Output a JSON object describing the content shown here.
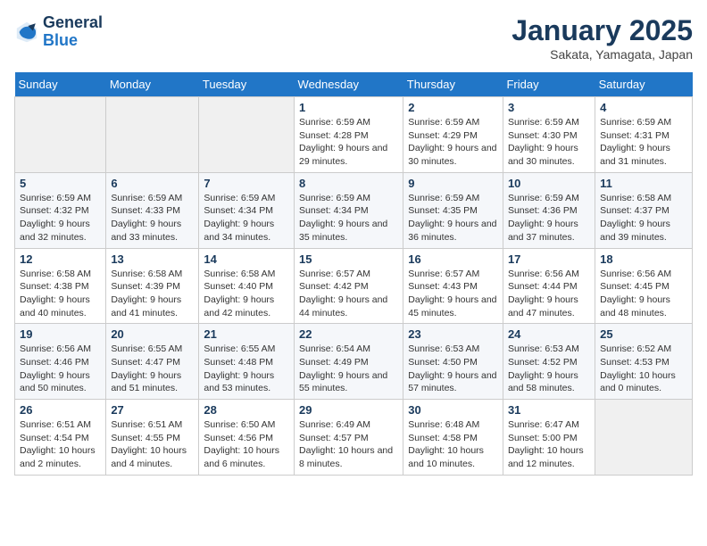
{
  "header": {
    "logo_line1": "General",
    "logo_line2": "Blue",
    "title": "January 2025",
    "subtitle": "Sakata, Yamagata, Japan"
  },
  "calendar": {
    "days_of_week": [
      "Sunday",
      "Monday",
      "Tuesday",
      "Wednesday",
      "Thursday",
      "Friday",
      "Saturday"
    ],
    "weeks": [
      [
        {
          "num": "",
          "detail": ""
        },
        {
          "num": "",
          "detail": ""
        },
        {
          "num": "",
          "detail": ""
        },
        {
          "num": "1",
          "detail": "Sunrise: 6:59 AM\nSunset: 4:28 PM\nDaylight: 9 hours and 29 minutes."
        },
        {
          "num": "2",
          "detail": "Sunrise: 6:59 AM\nSunset: 4:29 PM\nDaylight: 9 hours and 30 minutes."
        },
        {
          "num": "3",
          "detail": "Sunrise: 6:59 AM\nSunset: 4:30 PM\nDaylight: 9 hours and 30 minutes."
        },
        {
          "num": "4",
          "detail": "Sunrise: 6:59 AM\nSunset: 4:31 PM\nDaylight: 9 hours and 31 minutes."
        }
      ],
      [
        {
          "num": "5",
          "detail": "Sunrise: 6:59 AM\nSunset: 4:32 PM\nDaylight: 9 hours and 32 minutes."
        },
        {
          "num": "6",
          "detail": "Sunrise: 6:59 AM\nSunset: 4:33 PM\nDaylight: 9 hours and 33 minutes."
        },
        {
          "num": "7",
          "detail": "Sunrise: 6:59 AM\nSunset: 4:34 PM\nDaylight: 9 hours and 34 minutes."
        },
        {
          "num": "8",
          "detail": "Sunrise: 6:59 AM\nSunset: 4:34 PM\nDaylight: 9 hours and 35 minutes."
        },
        {
          "num": "9",
          "detail": "Sunrise: 6:59 AM\nSunset: 4:35 PM\nDaylight: 9 hours and 36 minutes."
        },
        {
          "num": "10",
          "detail": "Sunrise: 6:59 AM\nSunset: 4:36 PM\nDaylight: 9 hours and 37 minutes."
        },
        {
          "num": "11",
          "detail": "Sunrise: 6:58 AM\nSunset: 4:37 PM\nDaylight: 9 hours and 39 minutes."
        }
      ],
      [
        {
          "num": "12",
          "detail": "Sunrise: 6:58 AM\nSunset: 4:38 PM\nDaylight: 9 hours and 40 minutes."
        },
        {
          "num": "13",
          "detail": "Sunrise: 6:58 AM\nSunset: 4:39 PM\nDaylight: 9 hours and 41 minutes."
        },
        {
          "num": "14",
          "detail": "Sunrise: 6:58 AM\nSunset: 4:40 PM\nDaylight: 9 hours and 42 minutes."
        },
        {
          "num": "15",
          "detail": "Sunrise: 6:57 AM\nSunset: 4:42 PM\nDaylight: 9 hours and 44 minutes."
        },
        {
          "num": "16",
          "detail": "Sunrise: 6:57 AM\nSunset: 4:43 PM\nDaylight: 9 hours and 45 minutes."
        },
        {
          "num": "17",
          "detail": "Sunrise: 6:56 AM\nSunset: 4:44 PM\nDaylight: 9 hours and 47 minutes."
        },
        {
          "num": "18",
          "detail": "Sunrise: 6:56 AM\nSunset: 4:45 PM\nDaylight: 9 hours and 48 minutes."
        }
      ],
      [
        {
          "num": "19",
          "detail": "Sunrise: 6:56 AM\nSunset: 4:46 PM\nDaylight: 9 hours and 50 minutes."
        },
        {
          "num": "20",
          "detail": "Sunrise: 6:55 AM\nSunset: 4:47 PM\nDaylight: 9 hours and 51 minutes."
        },
        {
          "num": "21",
          "detail": "Sunrise: 6:55 AM\nSunset: 4:48 PM\nDaylight: 9 hours and 53 minutes."
        },
        {
          "num": "22",
          "detail": "Sunrise: 6:54 AM\nSunset: 4:49 PM\nDaylight: 9 hours and 55 minutes."
        },
        {
          "num": "23",
          "detail": "Sunrise: 6:53 AM\nSunset: 4:50 PM\nDaylight: 9 hours and 57 minutes."
        },
        {
          "num": "24",
          "detail": "Sunrise: 6:53 AM\nSunset: 4:52 PM\nDaylight: 9 hours and 58 minutes."
        },
        {
          "num": "25",
          "detail": "Sunrise: 6:52 AM\nSunset: 4:53 PM\nDaylight: 10 hours and 0 minutes."
        }
      ],
      [
        {
          "num": "26",
          "detail": "Sunrise: 6:51 AM\nSunset: 4:54 PM\nDaylight: 10 hours and 2 minutes."
        },
        {
          "num": "27",
          "detail": "Sunrise: 6:51 AM\nSunset: 4:55 PM\nDaylight: 10 hours and 4 minutes."
        },
        {
          "num": "28",
          "detail": "Sunrise: 6:50 AM\nSunset: 4:56 PM\nDaylight: 10 hours and 6 minutes."
        },
        {
          "num": "29",
          "detail": "Sunrise: 6:49 AM\nSunset: 4:57 PM\nDaylight: 10 hours and 8 minutes."
        },
        {
          "num": "30",
          "detail": "Sunrise: 6:48 AM\nSunset: 4:58 PM\nDaylight: 10 hours and 10 minutes."
        },
        {
          "num": "31",
          "detail": "Sunrise: 6:47 AM\nSunset: 5:00 PM\nDaylight: 10 hours and 12 minutes."
        },
        {
          "num": "",
          "detail": ""
        }
      ]
    ]
  }
}
